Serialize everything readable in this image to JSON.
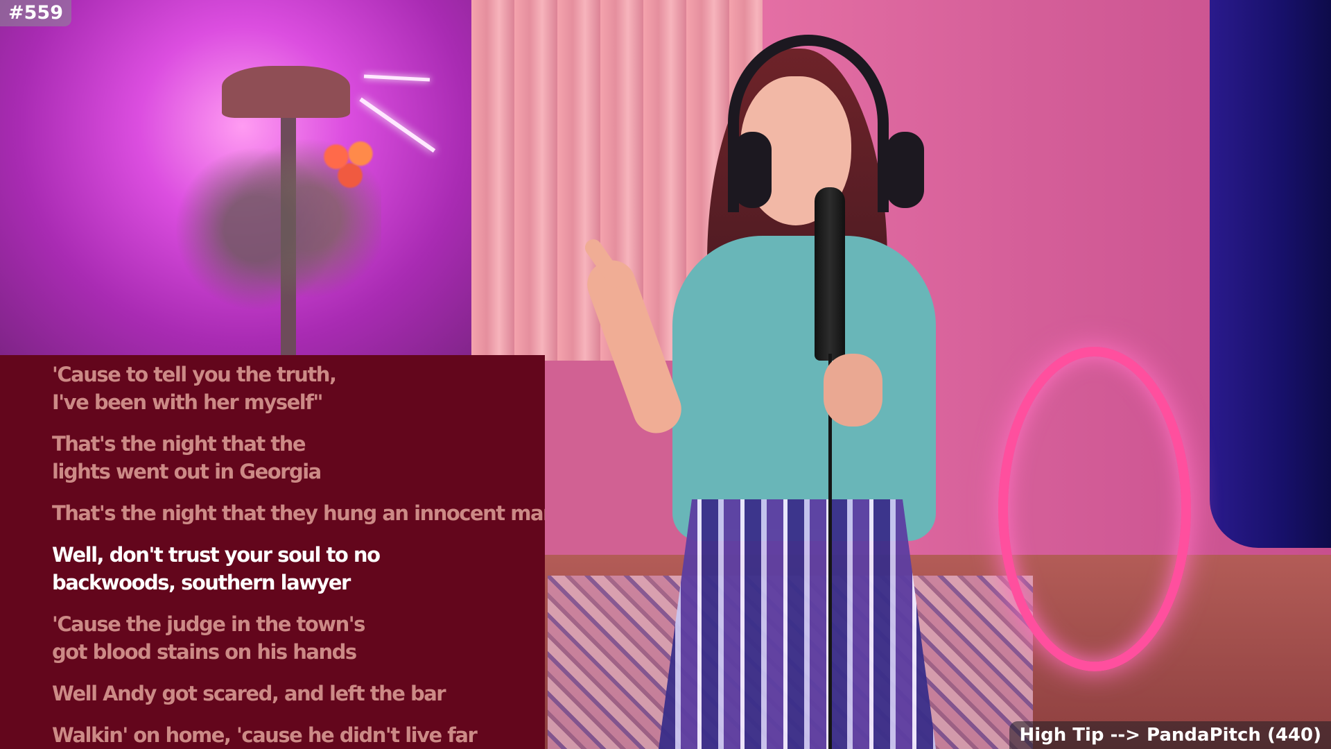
{
  "stream": {
    "episode_tag": "#559"
  },
  "lyrics": {
    "current_line_index": 3,
    "lines": [
      [
        "'Cause to tell you the truth,",
        "I've been with her myself\""
      ],
      [
        "That's the night that the",
        "lights went out in Georgia"
      ],
      [
        "That's the night that they hung an innocent man",
        ""
      ],
      [
        "Well, don't trust your soul to no",
        "backwoods, southern lawyer"
      ],
      [
        "'Cause the judge in the town's",
        "got blood stains on his hands"
      ],
      [
        "Well Andy got scared, and left the bar",
        ""
      ],
      [
        "Walkin' on home, 'cause he didn't live far",
        ""
      ]
    ]
  },
  "tip_banner": {
    "text": "High Tip --> PandaPitch (440)"
  },
  "colors": {
    "lyrics_panel_bg": "#63061c",
    "lyric_dim": "#cc8a86",
    "lyric_current": "#ffffff"
  }
}
